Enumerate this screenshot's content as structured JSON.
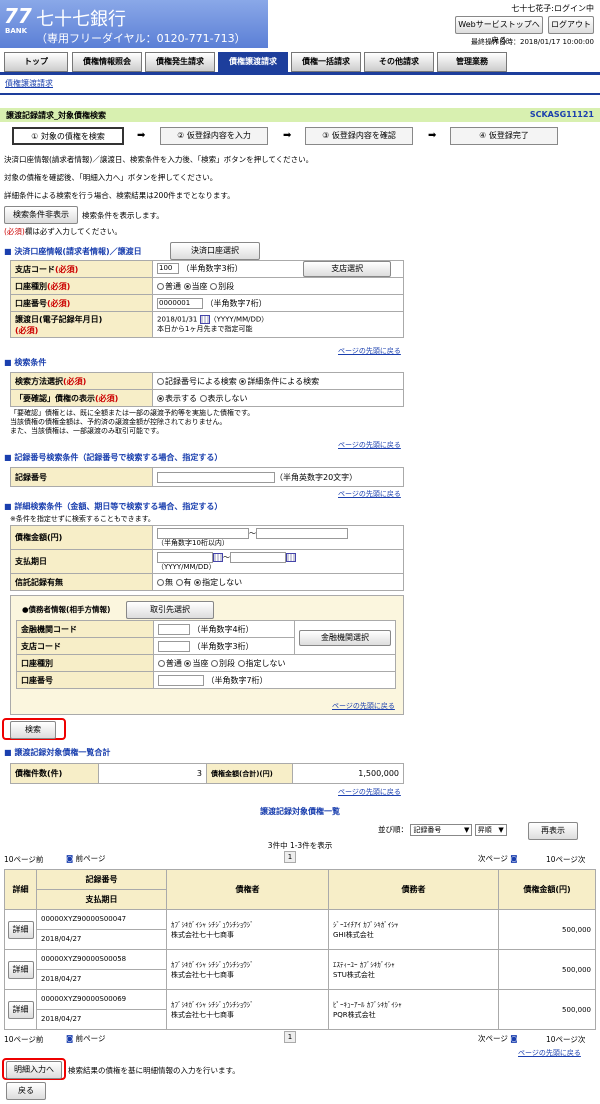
{
  "header": {
    "logo_number": "77",
    "logo_bank": "BANK",
    "bank_name": "七十七銀行",
    "toll_free": "（専用フリーダイヤル：0120-771-713）",
    "user_login": "七十七花子:ログイン中",
    "web_service_top_button": "Webサービストップへ戻る",
    "logout_button": "ログアウト",
    "last_operation": "最終操作日時：2018/01/17 10:00:00"
  },
  "tabs": [
    "トップ",
    "債権情報照会",
    "債権発生請求",
    "債権譲渡請求",
    "債権一括請求",
    "その他請求",
    "管理業務"
  ],
  "breadcrumb": "債権譲渡請求",
  "page": {
    "title": "譲渡記録請求_対象債権検索",
    "screen_id": "SCKASG11121"
  },
  "steps": [
    "① 対象の債権を検索",
    "② 仮登録内容を入力",
    "③ 仮登録内容を確認",
    "④ 仮登録完了"
  ],
  "instructions": [
    "決済口座情報(請求者情報)／譲渡日、検索条件を入力後、「検索」ボタンを押してください。",
    "対象の債権を確認後、「明細入力へ」ボタンを押してください。",
    "詳細条件による検索を行う場合、検索結果は200件までとなります。"
  ],
  "search_toggle": {
    "button": "検索条件非表示",
    "text": "検索条件を表示します。"
  },
  "required_note": {
    "mark": "(必須)",
    "text": "欄は必ず入力してください。"
  },
  "account_section": {
    "title": "決済口座情報(請求者情報)／譲渡日",
    "select_button": "決済口座選択",
    "branch_label": "支店コード",
    "branch_value": "100",
    "branch_hint": "（半角数字3桁）",
    "branch_button": "支店選択",
    "type_label": "口座種別",
    "type_options": [
      "普通",
      "当座",
      "別段"
    ],
    "number_label": "口座番号",
    "number_value": "0000001",
    "number_hint": "（半角数字7桁）",
    "date_label": "譲渡日(電子記録年月日)",
    "date_value": "2018/01/31",
    "date_hint": "（YYYY/MM/DD）",
    "date_note": "本日から1ヶ月先まで指定可能",
    "required": "(必須)"
  },
  "back_to_top": "ページの先頭に戻る",
  "search_section": {
    "title": "検索条件",
    "method_label": "検索方法選択",
    "method_options": [
      "記録番号による検索",
      "詳細条件による検索"
    ],
    "display_label": "「要確認」債権の表示",
    "display_options": [
      "表示する",
      "表示しない"
    ],
    "notes": [
      "「要確認」債権とは、既に全額または一部の譲渡予約等を実施した債権です。",
      "当該債権の債権金額は、予約済の譲渡金額が控除されておりません。",
      "また、当該債権は、一部譲渡のみ取引可能です。"
    ]
  },
  "record_section": {
    "title": "記録番号検索条件（記録番号で検索する場合、指定する）",
    "label": "記録番号",
    "hint": "（半角英数字20文字）"
  },
  "detail_section": {
    "title": "詳細検索条件（金額、期日等で検索する場合、指定する）",
    "note": "※条件を指定せずに検索することもできます。",
    "amount_label": "債権金額(円)",
    "amount_hint": "（半角数字10桁以内）",
    "due_label": "支払期日",
    "due_hint": "（YYYY/MM/DD）",
    "trust_label": "信託記録有無",
    "trust_options": [
      "無",
      "有",
      "指定しない"
    ],
    "tilde": "～",
    "debtor_title": "●債務者情報(相手方情報)",
    "partner_button": "取引先選択",
    "bank_code_label": "金融機関コード",
    "bank_code_hint": "（半角数字4桁）",
    "bank_select_button": "金融機関選択",
    "branch_label": "支店コード",
    "branch_hint": "（半角数字3桁）",
    "type_label": "口座種別",
    "type_options": [
      "普通",
      "当座",
      "別段",
      "指定しない"
    ],
    "number_label": "口座番号",
    "number_hint": "（半角数字7桁）"
  },
  "search_button": "検索",
  "total_section": {
    "title": "譲渡記録対象債権一覧合計",
    "count_label": "債権件数(件)",
    "count_value": "3",
    "amount_label": "債権金額(合計)(円)",
    "amount_value": "1,500,000"
  },
  "list": {
    "title": "譲渡記録対象債権一覧",
    "sort_label": "並び順：",
    "sort_value": "記録番号",
    "order_value": "昇順",
    "resort_button": "再表示",
    "count_text": "3件中 1-3件を表示",
    "prev10": "10ページ前",
    "prev": "前ページ",
    "page": "1",
    "next": "次ページ",
    "next10": "10ページ次",
    "headers": {
      "detail": "詳細",
      "record": "記録番号",
      "due": "支払期日",
      "creditor": "債権者",
      "debtor": "債務者",
      "amount": "債権金額(円)"
    },
    "detail_button": "詳細",
    "rows": [
      {
        "record": "00000XYZ90000S00047",
        "due": "2018/04/27",
        "creditor_kana": "ｶﾌﾞｼｷｶﾞｲｼｬ ｼﾁｼﾞｭｳｼﾁｼｮｳｼﾞ",
        "creditor": "株式会社七十七商事",
        "debtor_kana": "ｼﾞｰｴｲﾁｱｲ ｶﾌﾞｼｷｶﾞｲｼｬ",
        "debtor": "GHI株式会社",
        "amount": "500,000"
      },
      {
        "record": "00000XYZ90000S00058",
        "due": "2018/04/27",
        "creditor_kana": "ｶﾌﾞｼｷｶﾞｲｼｬ ｼﾁｼﾞｭｳｼﾁｼｮｳｼﾞ",
        "creditor": "株式会社七十七商事",
        "debtor_kana": "ｴｽﾃｨｰﾕｰ ｶﾌﾞｼｷｶﾞｲｼｬ",
        "debtor": "STU株式会社",
        "amount": "500,000"
      },
      {
        "record": "00000XYZ90000S00069",
        "due": "2018/04/27",
        "creditor_kana": "ｶﾌﾞｼｷｶﾞｲｼｬ ｼﾁｼﾞｭｳｼﾁｼｮｳｼﾞ",
        "creditor": "株式会社七十七商事",
        "debtor_kana": "ﾋﾟｰｷｭｰｱｰﾙ ｶﾌﾞｼｷｶﾞｲｼｬ",
        "debtor": "PQR株式会社",
        "amount": "500,000"
      }
    ]
  },
  "detail_input_button": "明細入力へ",
  "detail_input_text": "検索結果の債権を基に明細情報の入力を行います。",
  "back_button": "戻る"
}
